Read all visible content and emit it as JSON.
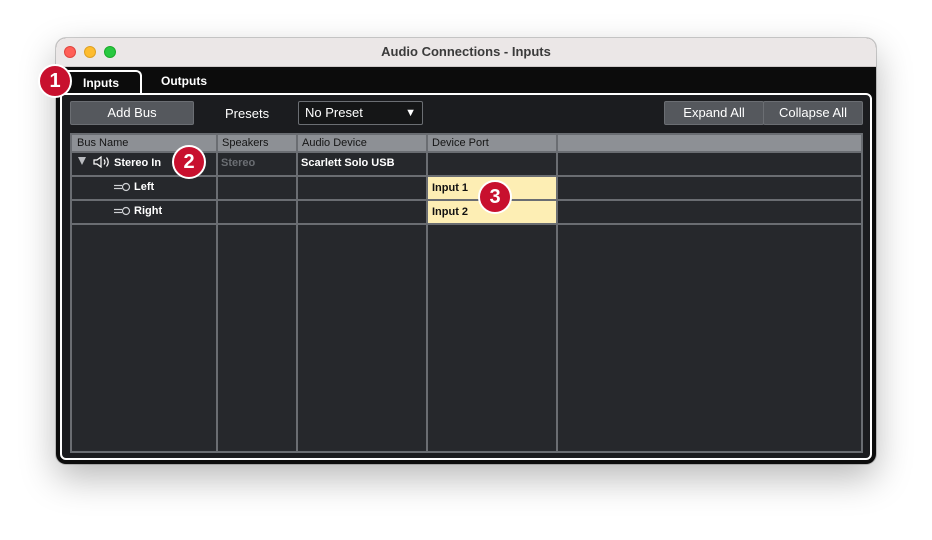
{
  "window": {
    "title": "Audio Connections - Inputs"
  },
  "tabs": [
    {
      "label": "Inputs",
      "active": true
    },
    {
      "label": "Outputs",
      "active": false
    }
  ],
  "toolbar": {
    "add_bus_label": "Add Bus",
    "presets_label": "Presets",
    "preset_value": "No Preset",
    "expand_all_label": "Expand All",
    "collapse_all_label": "Collapse All"
  },
  "table": {
    "columns": [
      "Bus Name",
      "Speakers",
      "Audio Device",
      "Device Port"
    ],
    "rows": [
      {
        "bus_name": "Stereo In",
        "speakers": "Stereo",
        "audio_device": "Scarlett Solo USB",
        "device_port": ""
      },
      {
        "bus_name": "Left",
        "speakers": "",
        "audio_device": "",
        "device_port": "Input 1"
      },
      {
        "bus_name": "Right",
        "speakers": "",
        "audio_device": "",
        "device_port": "Input 2"
      }
    ]
  },
  "callouts": [
    "1",
    "2",
    "3"
  ],
  "icons": {
    "expand": "triangle-down-icon",
    "bus": "speaker-icon",
    "channel": "jack-icon"
  },
  "colors": {
    "callout": "#c8102e",
    "port_highlight": "#fdeeb4",
    "panel_bg": "#26282c"
  }
}
